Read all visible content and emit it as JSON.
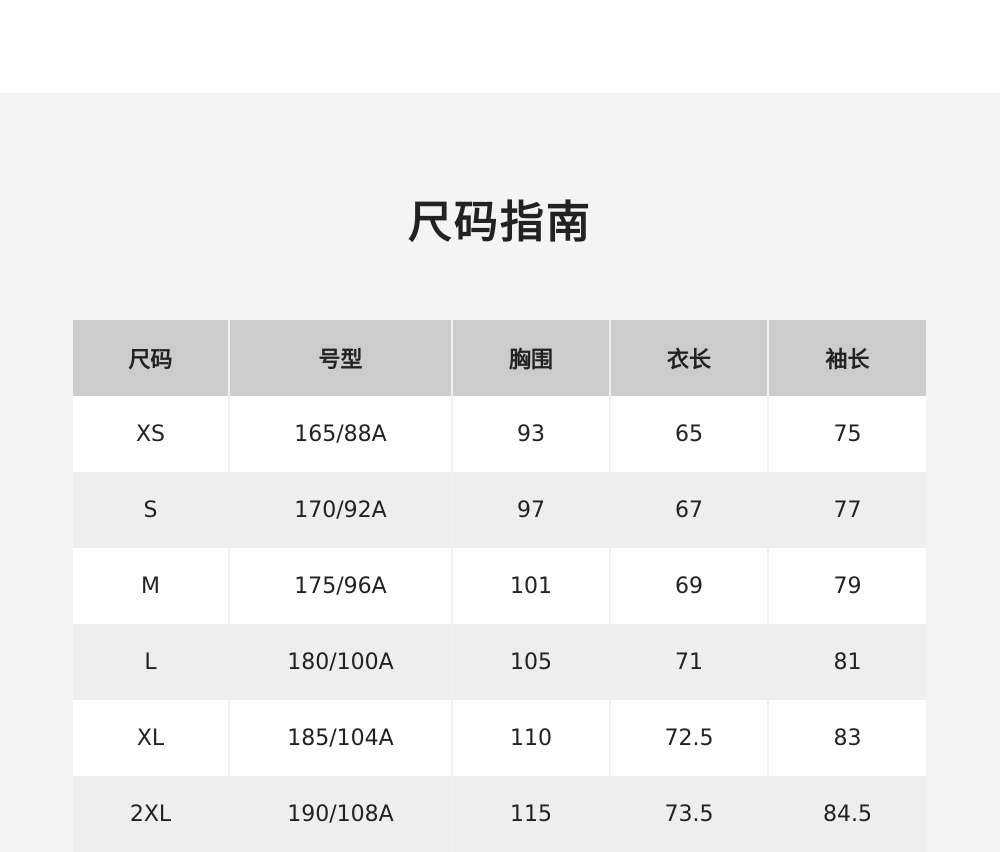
{
  "title": "尺码指南",
  "table": {
    "headers": [
      "尺码",
      "号型",
      "胸围",
      "衣长",
      "袖长"
    ],
    "rows": [
      [
        "XS",
        "165/88A",
        "93",
        "65",
        "75"
      ],
      [
        "S",
        "170/92A",
        "97",
        "67",
        "77"
      ],
      [
        "M",
        "175/96A",
        "101",
        "69",
        "79"
      ],
      [
        "L",
        "180/100A",
        "105",
        "71",
        "81"
      ],
      [
        "XL",
        "185/104A",
        "110",
        "72.5",
        "83"
      ],
      [
        "2XL",
        "190/108A",
        "115",
        "73.5",
        "84.5"
      ]
    ]
  },
  "colors": {
    "panel_bg": "#f4f4f4",
    "header_bg": "#cccccc",
    "row_alt_bg": "#eeeeee",
    "text": "#222222"
  }
}
